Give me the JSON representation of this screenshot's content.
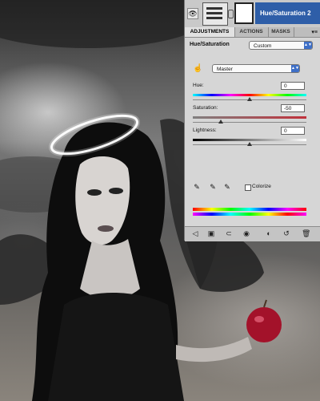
{
  "layers_panel": {
    "layer_name": "Hue/Saturation 2"
  },
  "tabs": [
    {
      "label": "ADJUSTMENTS",
      "active": true
    },
    {
      "label": "ACTIONS",
      "active": false
    },
    {
      "label": "MASKS",
      "active": false
    }
  ],
  "adjustment": {
    "title": "Hue/Saturation",
    "preset": "Custom",
    "channel": "Master",
    "hue_label": "Hue:",
    "hue_value": "0",
    "saturation_label": "Saturation:",
    "saturation_value": "-50",
    "lightness_label": "Lightness:",
    "lightness_value": "0",
    "colorize_label": "Colorize",
    "colorize_checked": false
  },
  "icons": {
    "visibility": "eye-icon",
    "target_adjust": "hand-scrubby-icon",
    "droppers": [
      "eyedropper-icon",
      "eyedropper-plus-icon",
      "eyedropper-minus-icon"
    ],
    "footer": [
      "back-arrow-icon",
      "expand-view-icon",
      "clip-layer-icon",
      "visibility-icon",
      "view-previous-icon",
      "reset-icon",
      "trash-icon"
    ]
  },
  "colors": {
    "selection": "#2e5ea8",
    "dropdown_accent": "#3e6fc7"
  }
}
